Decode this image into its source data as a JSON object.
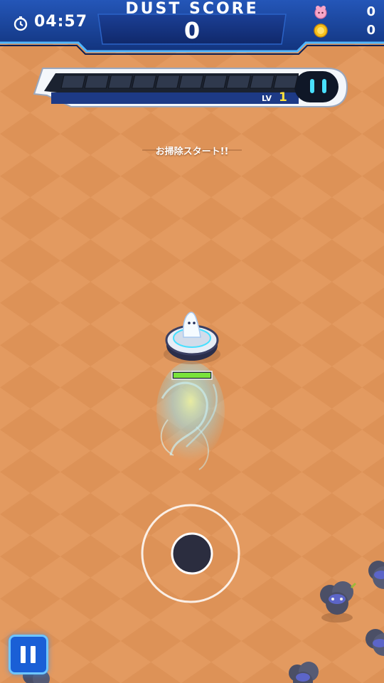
{
  "hud": {
    "timer": "04:57",
    "score_title": "DUST SCORE",
    "score_value": "0",
    "pink_count": "0",
    "coin_count": "0",
    "level_label": "LV",
    "level_value": "1",
    "exp_progress": 0
  },
  "message": "お掃除スタート!!",
  "player": {
    "health": 1.0
  },
  "icons": {
    "timer": "stopwatch-icon",
    "pink": "pink-creature-icon",
    "coin": "gold-coin-icon",
    "pause": "pause-icon"
  },
  "colors": {
    "ground": "#e0955a",
    "hud_blue": "#163e8f",
    "accent_cyan": "#49e0ff",
    "level_yellow": "#ffe23a",
    "health_green": "#7ae33b"
  }
}
